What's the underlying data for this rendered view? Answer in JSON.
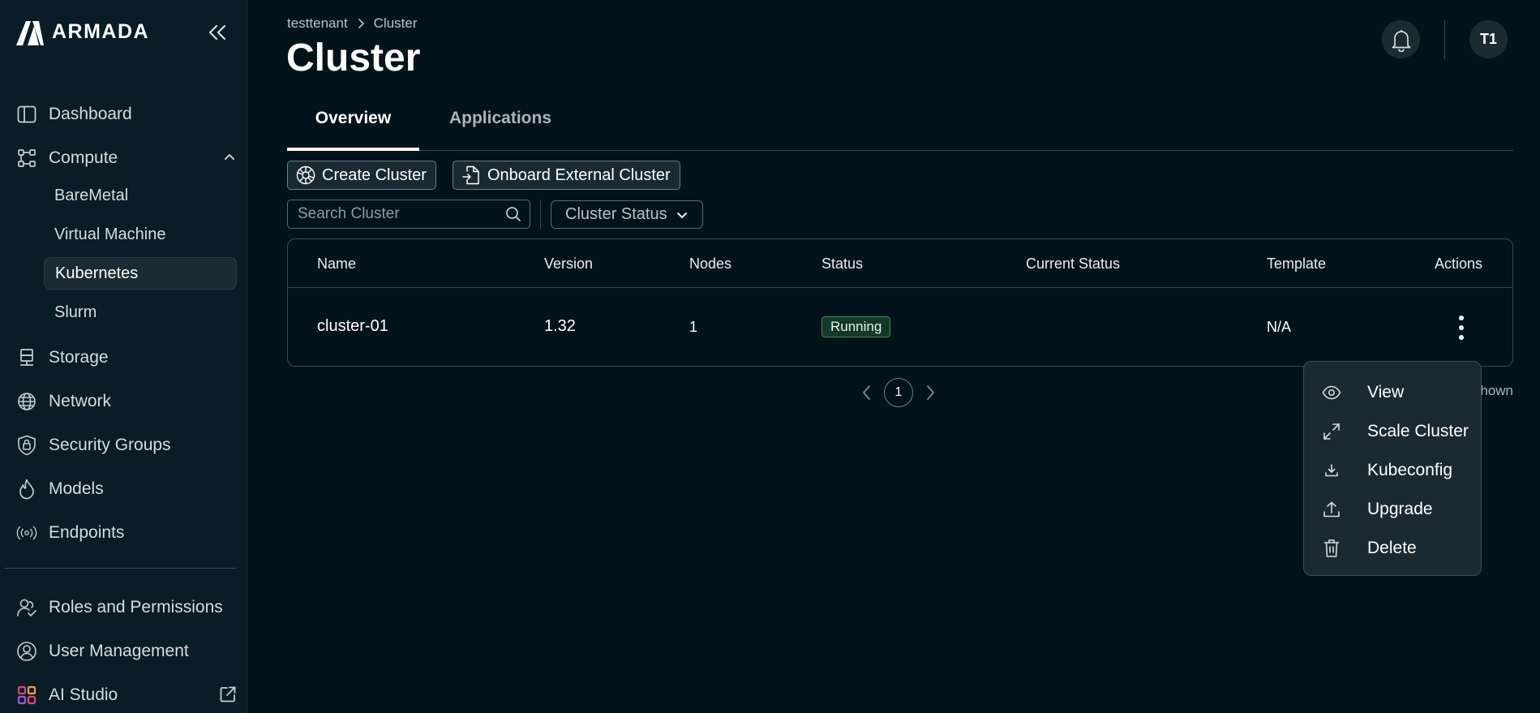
{
  "brand": {
    "name": "ARMADA"
  },
  "sidebar": {
    "items": [
      {
        "label": "Dashboard",
        "icon": "dashboard-icon"
      },
      {
        "label": "Compute",
        "icon": "compute-icon",
        "expanded": true,
        "children": [
          {
            "label": "BareMetal"
          },
          {
            "label": "Virtual Machine"
          },
          {
            "label": "Kubernetes",
            "active": true
          },
          {
            "label": "Slurm"
          }
        ]
      },
      {
        "label": "Storage",
        "icon": "storage-icon"
      },
      {
        "label": "Network",
        "icon": "globe-icon"
      },
      {
        "label": "Security Groups",
        "icon": "shield-lock-icon"
      },
      {
        "label": "Models",
        "icon": "flame-icon"
      },
      {
        "label": "Endpoints",
        "icon": "broadcast-icon"
      }
    ],
    "bottom": [
      {
        "label": "Roles and Permissions",
        "icon": "users-icon"
      },
      {
        "label": "User Management",
        "icon": "user-gear-icon"
      },
      {
        "label": "AI Studio",
        "icon": "grid-apps-icon"
      }
    ]
  },
  "breadcrumb": {
    "root": "testtenant",
    "current": "Cluster"
  },
  "page": {
    "title": "Cluster"
  },
  "header": {
    "avatar_initials": "T1"
  },
  "tabs": [
    {
      "label": "Overview",
      "active": true
    },
    {
      "label": "Applications",
      "active": false
    }
  ],
  "toolbar": {
    "create_label": "Create Cluster",
    "onboard_label": "Onboard External Cluster",
    "search_placeholder": "Search Cluster",
    "status_filter_label": "Cluster Status"
  },
  "table": {
    "columns": [
      "Name",
      "Version",
      "Nodes",
      "Status",
      "Current Status",
      "Template",
      "Actions"
    ],
    "rows": [
      {
        "name": "cluster-01",
        "version": "1.32",
        "nodes": "1",
        "status": "Running",
        "current_status": "",
        "template": "N/A"
      }
    ]
  },
  "pagination": {
    "current_page": "1",
    "shown_text": "hown"
  },
  "actions_menu": {
    "items": [
      {
        "label": "View",
        "icon": "eye-icon"
      },
      {
        "label": "Scale Cluster",
        "icon": "expand-icon"
      },
      {
        "label": "Kubeconfig",
        "icon": "download-icon"
      },
      {
        "label": "Upgrade",
        "icon": "upload-icon"
      },
      {
        "label": "Delete",
        "icon": "trash-icon"
      }
    ]
  },
  "colors": {
    "background": "#03131b",
    "sidebar": "#0a1c25",
    "badge_green": "#16382a",
    "menu": "#1b2a32"
  }
}
